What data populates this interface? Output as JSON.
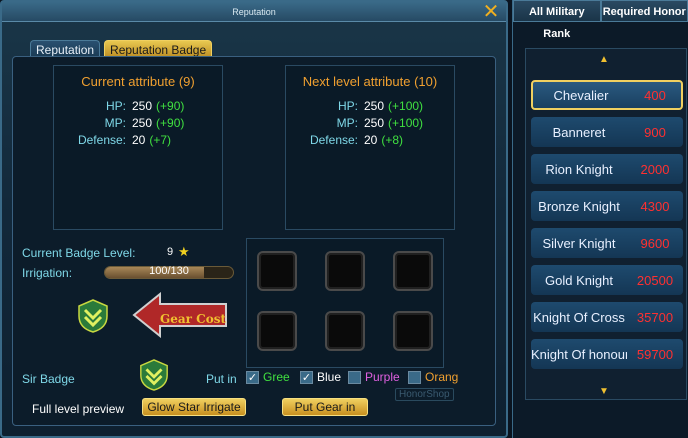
{
  "window": {
    "title": "Reputation"
  },
  "tabs": [
    {
      "label": "Reputation",
      "active": false
    },
    {
      "label": "Reputation Badge",
      "active": true
    }
  ],
  "current_attribute": {
    "title": "Current attribute (9)",
    "hp_label": "HP:",
    "hp": "250",
    "hp_bonus": "(+90)",
    "mp_label": "MP:",
    "mp": "250",
    "mp_bonus": "(+90)",
    "def_label": "Defense:",
    "def": "20",
    "def_bonus": "(+7)"
  },
  "next_attribute": {
    "title": "Next level attribute (10)",
    "hp_label": "HP:",
    "hp": "250",
    "hp_bonus": "(+100)",
    "mp_label": "MP:",
    "mp": "250",
    "mp_bonus": "(+100)",
    "def_label": "Defense:",
    "def": "20",
    "def_bonus": "(+8)"
  },
  "badge": {
    "level_label": "Current Badge Level:",
    "level": "9",
    "irrigation_label": "Irrigation:",
    "irrigation": "100/130",
    "irrigation_fraction": 0.77,
    "gear_cost_label": "Gear Cost",
    "sir_badge_label": "Sir Badge",
    "full_preview_label": "Full level preview"
  },
  "put_in": {
    "label": "Put in",
    "options": [
      {
        "label": "Gree",
        "checked": true,
        "color": "#40e040"
      },
      {
        "label": "Blue",
        "checked": true,
        "color": "#ffffff"
      },
      {
        "label": "Purple",
        "checked": false,
        "color": "#e060e0"
      },
      {
        "label": "Orang",
        "checked": false,
        "color": "#f0a030"
      }
    ]
  },
  "buttons": {
    "glow_star": "Glow Star Irrigate",
    "put_gear": "Put Gear in",
    "honor_shop": "HonorShop"
  },
  "side": {
    "col1": "All Military Rank",
    "col2": "Required Honor",
    "ranks": [
      {
        "name": "Chevalier",
        "honor": "400",
        "selected": true
      },
      {
        "name": "Banneret",
        "honor": "900"
      },
      {
        "name": "Rion Knight",
        "honor": "2000"
      },
      {
        "name": "Bronze Knight",
        "honor": "4300"
      },
      {
        "name": "Silver Knight",
        "honor": "9600"
      },
      {
        "name": "Gold Knight",
        "honor": "20500"
      },
      {
        "name": "Knight Of Cross",
        "honor": "35700"
      },
      {
        "name": "Knight Of honour",
        "honor": "59700"
      }
    ]
  },
  "colors": {
    "accent": "#f0c030",
    "honor_red": "#ff3030",
    "bonus_green": "#40e040",
    "label_cyan": "#7fd8e8"
  }
}
